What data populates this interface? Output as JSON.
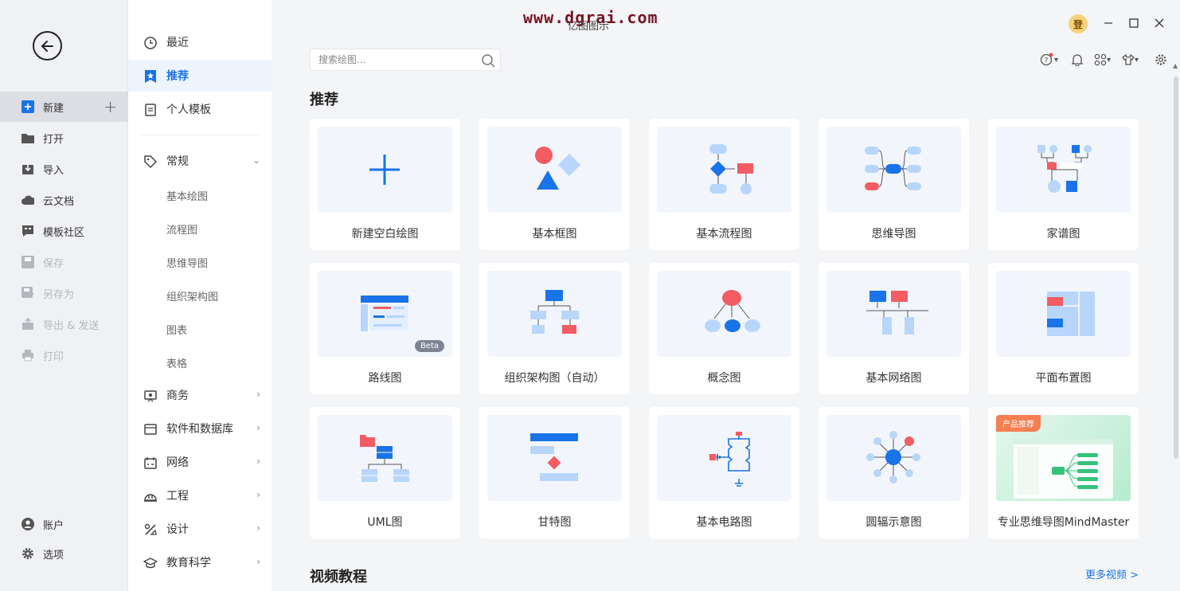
{
  "window": {
    "title": "亿图图示",
    "watermark": "www.dgrai.com",
    "avatar_text": "登"
  },
  "rail": {
    "items": [
      {
        "label": "新建",
        "icon": "new-file-icon",
        "active": true,
        "disabled": false
      },
      {
        "label": "打开",
        "icon": "folder-icon",
        "active": false,
        "disabled": false
      },
      {
        "label": "导入",
        "icon": "import-icon",
        "active": false,
        "disabled": false
      },
      {
        "label": "云文档",
        "icon": "cloud-icon",
        "active": false,
        "disabled": false
      },
      {
        "label": "模板社区",
        "icon": "community-icon",
        "active": false,
        "disabled": false
      },
      {
        "label": "保存",
        "icon": "save-icon",
        "active": false,
        "disabled": true
      },
      {
        "label": "另存为",
        "icon": "save-as-icon",
        "active": false,
        "disabled": true
      },
      {
        "label": "导出 & 发送",
        "icon": "export-icon",
        "active": false,
        "disabled": true
      },
      {
        "label": "打印",
        "icon": "print-icon",
        "active": false,
        "disabled": true
      }
    ],
    "bottom": [
      {
        "label": "账户",
        "icon": "account-icon"
      },
      {
        "label": "选项",
        "icon": "settings-icon"
      }
    ]
  },
  "categories": {
    "top": [
      {
        "label": "最近",
        "icon": "clock-icon"
      },
      {
        "label": "推荐",
        "icon": "star-icon",
        "active": true
      },
      {
        "label": "个人模板",
        "icon": "template-icon"
      }
    ],
    "general": {
      "label": "常规",
      "icon": "tag-icon"
    },
    "general_subs": [
      "基本绘图",
      "流程图",
      "思维导图",
      "组织架构图",
      "图表",
      "表格"
    ],
    "groups": [
      {
        "label": "商务",
        "icon": "presentation-icon"
      },
      {
        "label": "软件和数据库",
        "icon": "database-icon"
      },
      {
        "label": "网络",
        "icon": "network-icon"
      },
      {
        "label": "工程",
        "icon": "helmet-icon"
      },
      {
        "label": "设计",
        "icon": "design-icon"
      },
      {
        "label": "教育科学",
        "icon": "education-icon"
      }
    ]
  },
  "search": {
    "placeholder": "搜索绘图..."
  },
  "main": {
    "section_title": "推荐",
    "video_title": "视频教程",
    "more_videos": "更多视频 >",
    "cards": [
      "新建空白绘图",
      "基本框图",
      "基本流程图",
      "思维导图",
      "家谱图",
      "路线图",
      "组织架构图（自动）",
      "概念图",
      "基本网络图",
      "平面布置图",
      "UML图",
      "甘特图",
      "基本电路图",
      "圆辐示意图",
      "专业思维导图MindMaster"
    ],
    "beta_label": "Beta",
    "promo_label": "产品推荐"
  },
  "colors": {
    "accent": "#1a73e8",
    "red": "#f25c62",
    "light_blue": "#b8d6fb"
  }
}
